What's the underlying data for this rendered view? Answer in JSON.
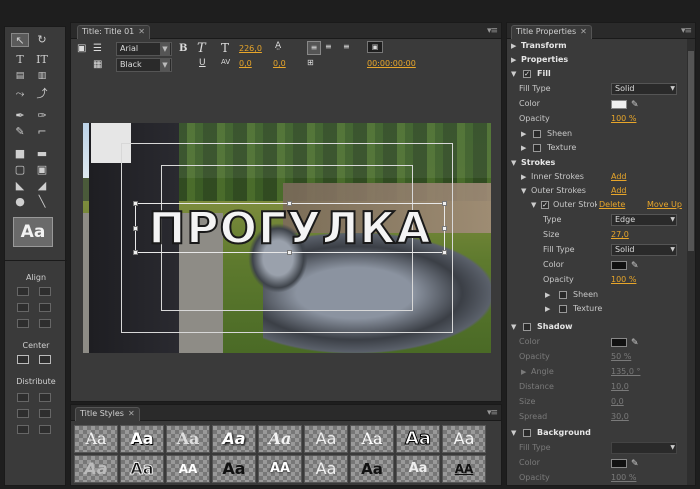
{
  "editor": {
    "tab_title": "Title: Title 01",
    "font_family": "Arial",
    "font_style": "Black",
    "font_size": "226,0",
    "kerning": "0,0",
    "leading": "0,0",
    "tracking": "0,0",
    "timecode": "00:00:00:00",
    "title_text": "ПРОГУЛКА"
  },
  "tools": {
    "style_sample": "Aa",
    "align_label": "Align",
    "center_label": "Center",
    "distribute_label": "Distribute"
  },
  "styles": {
    "tab_title": "Title Styles",
    "swatch_label": "Aa",
    "row1": [
      "Aa",
      "Aa",
      "Aa",
      "Aa",
      "Aa",
      "Aa",
      "Aa",
      "Aa",
      "Aa"
    ],
    "row2": [
      "Aa",
      "Aa",
      "AA",
      "Aa",
      "AA",
      "Aa",
      "Aa",
      "Aa",
      "AA"
    ]
  },
  "props": {
    "tab_title": "Title Properties",
    "transform": "Transform",
    "properties": "Properties",
    "fill": "Fill",
    "fill_type_label": "Fill Type",
    "fill_type_value": "Solid",
    "color_label": "Color",
    "opacity_label": "Opacity",
    "opacity_value": "100 %",
    "sheen": "Sheen",
    "texture": "Texture",
    "strokes": "Strokes",
    "inner_strokes": "Inner Strokes",
    "outer_strokes": "Outer Strokes",
    "add": "Add",
    "outer_stroke": "Outer Stroke",
    "delete": "Delete",
    "move_up": "Move Up",
    "type_label": "Type",
    "type_value": "Edge",
    "size_label": "Size",
    "size_value": "27,0",
    "stroke_fill_type_value": "Solid",
    "stroke_opacity_value": "100 %",
    "shadow": "Shadow",
    "shadow_opacity_value": "50 %",
    "angle_label": "Angle",
    "angle_value": "135,0 °",
    "distance_label": "Distance",
    "distance_value": "10,0",
    "shadow_size_value": "0,0",
    "spread_label": "Spread",
    "spread_value": "30,0",
    "background": "Background",
    "bg_opacity_value": "100 %"
  },
  "colors": {
    "accent": "#e8a62a",
    "fill_color": "#f0f0f0",
    "stroke_color": "#111111",
    "shadow_color": "#111111",
    "bg_color": "#111111"
  }
}
